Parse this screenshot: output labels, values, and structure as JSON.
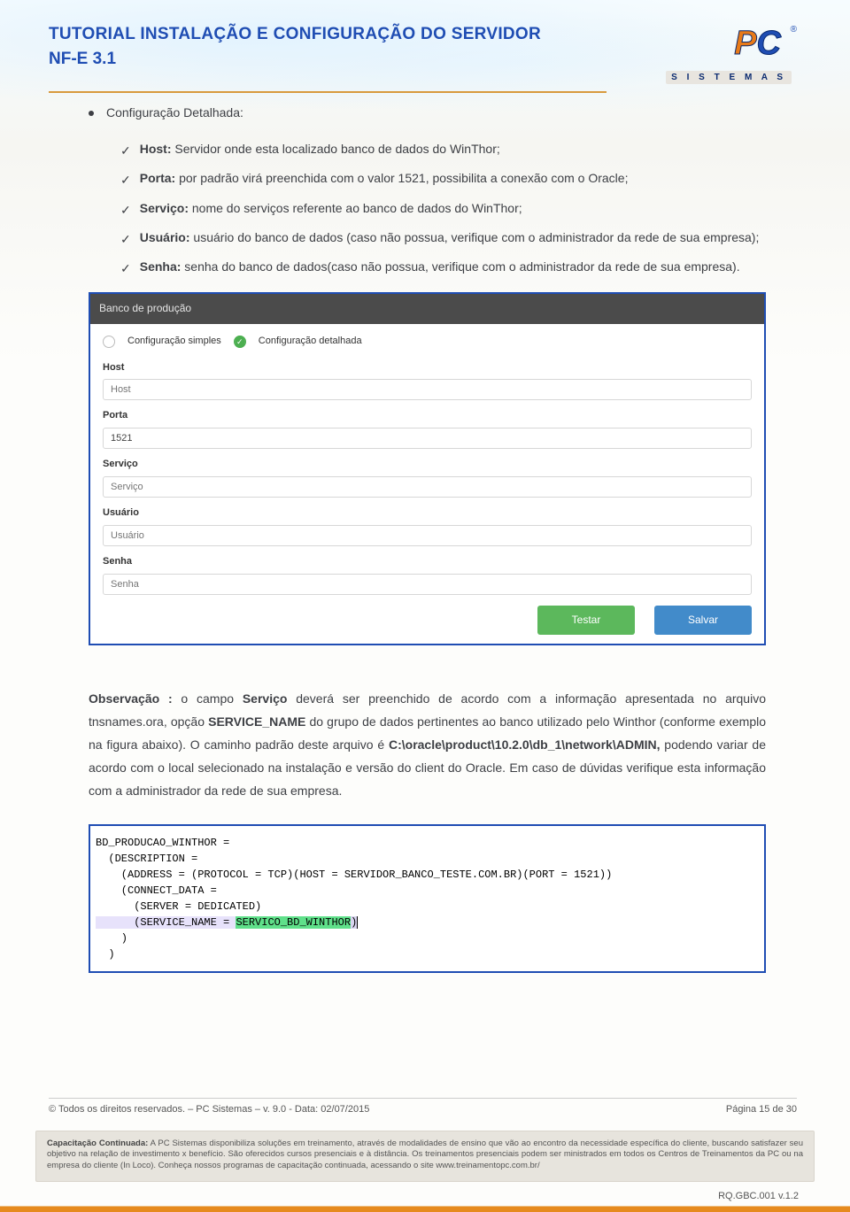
{
  "header": {
    "title_line1": "TUTORIAL INSTALAÇÃO E CONFIGURAÇÃO DO SERVIDOR",
    "title_line2": "NF-E 3.1",
    "logo_text": "PC",
    "logo_sub": "S I S T E M A S",
    "logo_reg": "®"
  },
  "section": {
    "bullet_title": "Configuração Detalhada:",
    "items": {
      "host": {
        "label": "Host:",
        "text": " Servidor onde esta localizado banco de dados do WinThor;"
      },
      "porta": {
        "label": "Porta:",
        "text": " por padrão virá preenchida com o valor 1521, possibilita a conexão com o Oracle;"
      },
      "servico": {
        "label": "Serviço:",
        "text": " nome do serviços referente ao banco de dados do WinThor;"
      },
      "usuario": {
        "label": "Usuário:",
        "text": " usuário do banco de dados (caso não possua, verifique com o administrador da rede de sua empresa);"
      },
      "senha": {
        "label": "Senha:",
        "text": " senha do banco de dados(caso não possua, verifique com o administrador da rede de sua empresa)."
      }
    }
  },
  "form": {
    "panel_title": "Banco de produção",
    "radio_simple": "Configuração simples",
    "radio_detailed": "Configuração detalhada",
    "labels": {
      "host": "Host",
      "porta": "Porta",
      "servico": "Serviço",
      "usuario": "Usuário",
      "senha": "Senha"
    },
    "placeholders": {
      "host": "Host",
      "servico": "Serviço",
      "usuario": "Usuário",
      "senha": "Senha"
    },
    "values": {
      "porta": "1521"
    },
    "btn_test": "Testar",
    "btn_save": "Salvar"
  },
  "observation": {
    "label": "Observação :",
    "t1": " o campo ",
    "svc": "Serviço",
    "t2": " deverá ser preenchido de acordo com a informação apresentada no arquivo tnsnames.ora, opção ",
    "sname": "SERVICE_NAME",
    "t3": " do grupo de dados pertinentes ao banco utilizado pelo Winthor (conforme exemplo na figura abaixo). O caminho padrão deste arquivo é ",
    "path": "C:\\oracle\\product\\10.2.0\\db_1\\network\\ADMIN,",
    "t4": " podendo variar de acordo com o local selecionado na instalação e versão do client do Oracle. Em caso de dúvidas verifique esta informação com a administrador da rede de sua empresa."
  },
  "code": {
    "l1": "BD_PRODUCAO_WINTHOR =",
    "l2": "  (DESCRIPTION =",
    "l3": "    (ADDRESS = (PROTOCOL = TCP)(HOST = SERVIDOR_BANCO_TESTE.COM.BR)(PORT = 1521))",
    "l4": "    (CONNECT_DATA =",
    "l5": "      (SERVER = DEDICATED)",
    "l6a": "      (SERVICE_NAME = ",
    "l6b": "SERVICO_BD_WINTHOR",
    "l6c": ")",
    "l7": "    )",
    "l8": "  )"
  },
  "footer": {
    "left": "© Todos os direitos reservados. – PC Sistemas – v. 9.0 - Data: 02/07/2015",
    "right": "Página 15 de 30"
  },
  "training": {
    "title": "Capacitação Continuada:",
    "body": " A PC Sistemas disponibiliza soluções em treinamento, através de modalidades de ensino que vão ao encontro da necessidade específica do cliente, buscando satisfazer seu objetivo na relação de investimento x benefício. São oferecidos cursos presenciais e à distância. Os treinamentos presenciais podem ser ministrados em todos os Centros de Treinamentos da PC ou na empresa do cliente (In Loco). Conheça nossos programas de capacitação continuada, acessando o site www.treinamentopc.com.br/"
  },
  "rq": "RQ.GBC.001 v.1.2"
}
